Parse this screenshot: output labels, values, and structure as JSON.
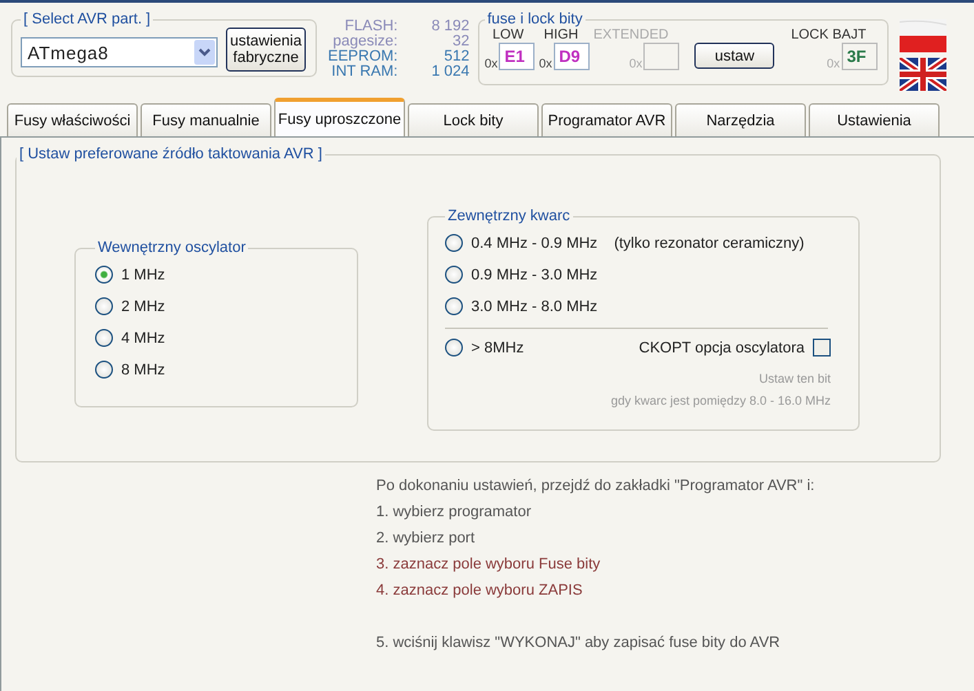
{
  "part_group": {
    "title": "[ Select AVR part. ]",
    "device": "ATmega8",
    "factory_button": "ustawienia fabryczne"
  },
  "memory_info": [
    {
      "label": "FLASH:",
      "value": "8 192",
      "color": "#8a8ab8"
    },
    {
      "label": "pagesize:",
      "value": "32",
      "color": "#8a8ab8"
    },
    {
      "label": "EEPROM:",
      "value": "512",
      "color": "#3a78b0"
    },
    {
      "label": "INT RAM:",
      "value": "1 024",
      "color": "#3a78b0"
    }
  ],
  "fuse_group": {
    "title": "fuse i lock bity",
    "fields": [
      {
        "label": "LOW",
        "prefix": "0x",
        "value": "E1",
        "color": "#c030c0"
      },
      {
        "label": "HIGH",
        "prefix": "0x",
        "value": "D9",
        "color": "#c030c0"
      }
    ],
    "extended": {
      "label": "EXTENDED",
      "prefix": "0x",
      "disabled": true
    },
    "set_button": "ustaw",
    "lock": {
      "label": "LOCK BAJT",
      "prefix": "0x",
      "value": "3F",
      "color": "#2a7a4a"
    }
  },
  "tabs": [
    {
      "label": "Fusy właściwości",
      "selected": false
    },
    {
      "label": "Fusy manualnie",
      "selected": false
    },
    {
      "label": "Fusy uproszczone",
      "selected": true
    },
    {
      "label": "Lock bity",
      "selected": false
    },
    {
      "label": "Programator AVR",
      "selected": false
    },
    {
      "label": "Narzędzia",
      "selected": false
    },
    {
      "label": "Ustawienia",
      "selected": false
    }
  ],
  "clock_group": {
    "title": "[ Ustaw preferowane źródło taktowania AVR ]",
    "internal": {
      "title": "Wewnętrzny oscylator",
      "options": [
        {
          "label": "1 MHz",
          "selected": true
        },
        {
          "label": "2 MHz",
          "selected": false
        },
        {
          "label": "4 MHz",
          "selected": false
        },
        {
          "label": "8 MHz",
          "selected": false
        }
      ]
    },
    "external": {
      "title": "Zewnętrzny kwarc",
      "options": [
        {
          "label": "0.4 MHz - 0.9 MHz",
          "note": "(tylko rezonator ceramiczny)",
          "selected": false
        },
        {
          "label": "0.9 MHz - 3.0 MHz",
          "selected": false
        },
        {
          "label": "3.0 MHz - 8.0 MHz",
          "selected": false
        }
      ],
      "high_option": {
        "label": "> 8MHz",
        "selected": false
      },
      "ckopt": {
        "label": "CKOPT opcja oscylatora",
        "checked": false
      },
      "hints": [
        "Ustaw ten bit",
        "gdy kwarc jest pomiędzy 8.0 - 16.0 MHz"
      ]
    }
  },
  "instructions": {
    "steps": [
      {
        "text": "Po dokonaniu ustawień, przejdź do zakładki \"Programator AVR\" i:",
        "color": "#555555"
      },
      {
        "text": "1. wybierz programator",
        "color": "#555555"
      },
      {
        "text": "2. wybierz port",
        "color": "#555555"
      },
      {
        "text": "3. zaznacz pole wyboru Fuse bity",
        "color": "#8a3a3a"
      },
      {
        "text": "4. zaznacz pole wyboru ZAPIS",
        "color": "#8a3a3a"
      }
    ],
    "final": {
      "text": "5. wciśnij klawisz \"WYKONAJ\" aby zapisać fuse bity do AVR",
      "color": "#555555"
    }
  }
}
